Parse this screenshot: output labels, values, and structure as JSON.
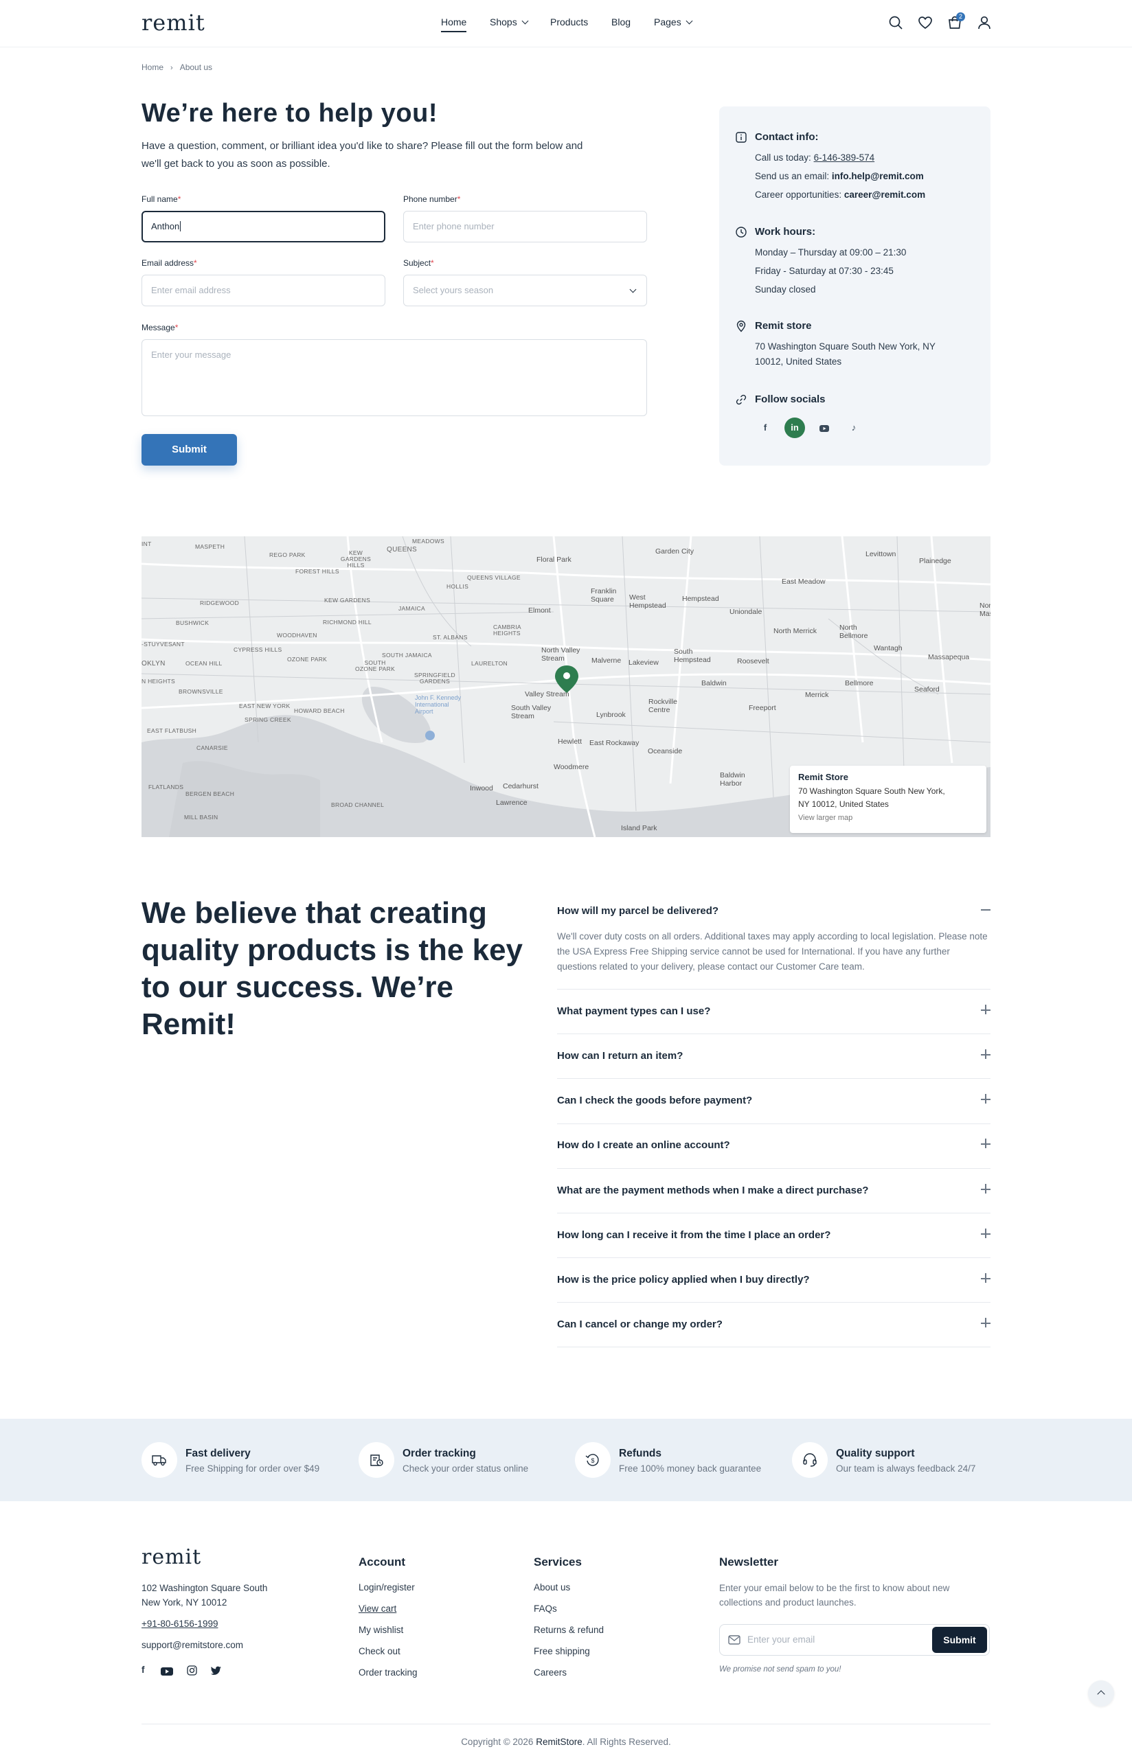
{
  "brand": {
    "logo": "remit"
  },
  "nav": {
    "items": [
      {
        "label": "Home"
      },
      {
        "label": "Shops"
      },
      {
        "label": "Products"
      },
      {
        "label": "Blog"
      },
      {
        "label": "Pages"
      }
    ],
    "cart_count": "2"
  },
  "breadcrumb": {
    "home": "Home",
    "current": "About us"
  },
  "hero": {
    "title": "We’re here to help you!",
    "lead": "Have a question, comment, or brilliant idea you'd like to share? Please fill out the form below and we'll get back to you as soon as possible."
  },
  "form": {
    "full_name": {
      "label": "Full name",
      "value": "Anthon"
    },
    "phone": {
      "label": "Phone number",
      "placeholder": "Enter phone number"
    },
    "email": {
      "label": "Email address",
      "placeholder": "Enter email address"
    },
    "subject": {
      "label": "Subject",
      "placeholder": "Select yours season"
    },
    "message": {
      "label": "Message",
      "placeholder": "Enter your message"
    },
    "required_mark": "*",
    "submit": "Submit"
  },
  "contact": {
    "info_title": "Contact info:",
    "call_label": "Call us today:",
    "call_value": "6-146-389-574",
    "email_label": "Send us an email:",
    "email_value": "info.help@remit.com",
    "career_label": "Career opportunities:",
    "career_value": "career@remit.com",
    "hours_title": "Work hours:",
    "hours": [
      "Monday – Thursday at 09:00 – 21:30",
      "Friday - Saturday at 07:30 - 23:45",
      "Sunday closed"
    ],
    "store_title": "Remit store",
    "store_address": [
      "70 Washington Square South New York, NY",
      "10012, United States"
    ],
    "socials_title": "Follow socials"
  },
  "map": {
    "labels": {
      "floral_park": "Floral Park",
      "garden_city": "Garden City",
      "levittown": "Levittown",
      "plainedge": "Plainedge",
      "east_meadow": "East Meadow",
      "franklin_square": "Franklin Square",
      "west_hempstead": "West Hempstead",
      "hempstead": "Hempstead",
      "elmont": "Elmont",
      "uniondale": "Uniondale",
      "north_massapequa": "North Massapequa",
      "north_merrick": "North Merrick",
      "north_bellmore": "North Bellmore",
      "wantagh": "Wantagh",
      "north_valley_stream": "North Valley Stream",
      "malverne": "Malverne",
      "lakeview": "Lakeview",
      "south_hempstead": "South Hempstead",
      "roosevelt": "Roosevelt",
      "massapequa": "Massapequa",
      "baldwin": "Baldwin",
      "bellmore": "Bellmore",
      "seaford": "Seaford",
      "merrick": "Merrick",
      "valley_stream": "Valley Stream",
      "rockville_centre": "Rockville Centre",
      "freeport": "Freeport",
      "south_valley_stream": "South Valley Stream",
      "lynbrook": "Lynbrook",
      "hewlett": "Hewlett",
      "east_rockaway": "East Rockaway",
      "oceanside": "Oceanside",
      "woodmere": "Woodmere",
      "inwood": "Inwood",
      "cedarhurst": "Cedarhurst",
      "lawrence": "Lawrence",
      "baldwin_harbor": "Baldwin Harbor",
      "island_park": "Island Park",
      "jfk": "John F. Kennedy International Airport",
      "maspeth": "MASPETH",
      "rego_park": "REGO PARK",
      "forest_hills": "FOREST HILLS",
      "kew_gardens_hills": "KEW GARDENS HILLS",
      "queens": "QUEENS",
      "meadows": "MEADOWS",
      "queens_village": "QUEENS VILLAGE",
      "hollis": "HOLLIS",
      "ridgewood": "RIDGEWOOD",
      "kew_gardens": "KEW GARDENS",
      "jamaica": "JAMAICA",
      "bushwick": "BUSHWICK",
      "richmond_hill": "RICHMOND HILL",
      "woodhaven": "WOODHAVEN",
      "st_albans": "ST. ALBANS",
      "cambria_heights": "CAMBRIA HEIGHTS",
      "stuyvesant": "-STUYVESANT",
      "cypress_hills": "CYPRESS HILLS",
      "ozone_park": "OZONE PARK",
      "south_jamaica": "SOUTH JAMAICA",
      "south_ozone_park": "SOUTH OZONE PARK",
      "laurelton": "LAURELTON",
      "ocean_hill": "OCEAN HILL",
      "springfield_gardens": "SPRINGFIELD GARDENS",
      "brooklyn": "OKLYN",
      "heights": "N HEIGHTS",
      "brownsville": "BROWNSVILLE",
      "east_new_york": "EAST NEW YORK",
      "howard_beach": "HOWARD BEACH",
      "spring_creek": "SPRING CREEK",
      "east_flatbush": "EAST FLATBUSH",
      "canarsie": "CANARSIE",
      "flatlands": "FLATLANDS",
      "bergen_beach": "BERGEN BEACH",
      "broad_channel": "BROAD CHANNEL",
      "mill_basin": "MILL BASIN",
      "int": "INT"
    },
    "card_title": "Remit Store",
    "card_address": [
      "70 Washington Square South New York,",
      "NY 10012, United States"
    ],
    "card_link": "View larger map"
  },
  "faq": {
    "heading": "We believe that creating quality products is the key to our success. We’re Remit!",
    "open_answer": "We'll cover duty costs on all orders. Additional taxes may apply according to local legislation. Please note the USA Express Free Shipping service cannot be used for International. If you have any further questions related to your delivery, please contact our Customer Care team.",
    "questions": [
      "How will my parcel be delivered?",
      "What payment types can I use?",
      "How can I return an item?",
      "Can I check the goods before payment?",
      "How do I create an online account?",
      "What are the payment methods when I make a direct purchase?",
      "How long can I receive it from the time I place an order?",
      "How is the price policy applied when I buy directly?",
      "Can I cancel or change my order?"
    ]
  },
  "features": [
    {
      "title": "Fast delivery",
      "desc": "Free Shipping for order over $49",
      "icon": "truck-icon"
    },
    {
      "title": "Order tracking",
      "desc": "Check your order status online",
      "icon": "tracking-icon"
    },
    {
      "title": "Refunds",
      "desc": "Free 100% money back guarantee",
      "icon": "refund-icon"
    },
    {
      "title": "Quality support",
      "desc": "Our team is always feedback 24/7",
      "icon": "headset-icon"
    }
  ],
  "footer": {
    "address": [
      "102 Washington Square South",
      "New York, NY 10012"
    ],
    "phone": "+91-80-6156-1999",
    "email": "support@remitstore.com",
    "account_title": "Account",
    "account_links": [
      "Login/register",
      "View cart",
      "My wishlist",
      "Check out",
      "Order tracking"
    ],
    "services_title": "Services",
    "services_links": [
      "About us",
      "FAQs",
      "Returns & refund",
      "Free shipping",
      "Careers"
    ],
    "newsletter_title": "Newsletter",
    "newsletter_text": "Enter your email below to be the first to know about new collections and product launches.",
    "newsletter_placeholder": "Enter your email",
    "newsletter_button": "Submit",
    "newsletter_note": "We promise not send spam to you!",
    "copyright_pre": "Copyright © 2026",
    "copyright_brand": "RemitStore",
    "copyright_post": ". All Rights Reserved."
  },
  "colors": {
    "accent": "#3474b8",
    "navy": "#1b2a3a",
    "pin": "#2e7d4f",
    "feature_bg": "#eaf0f6"
  }
}
